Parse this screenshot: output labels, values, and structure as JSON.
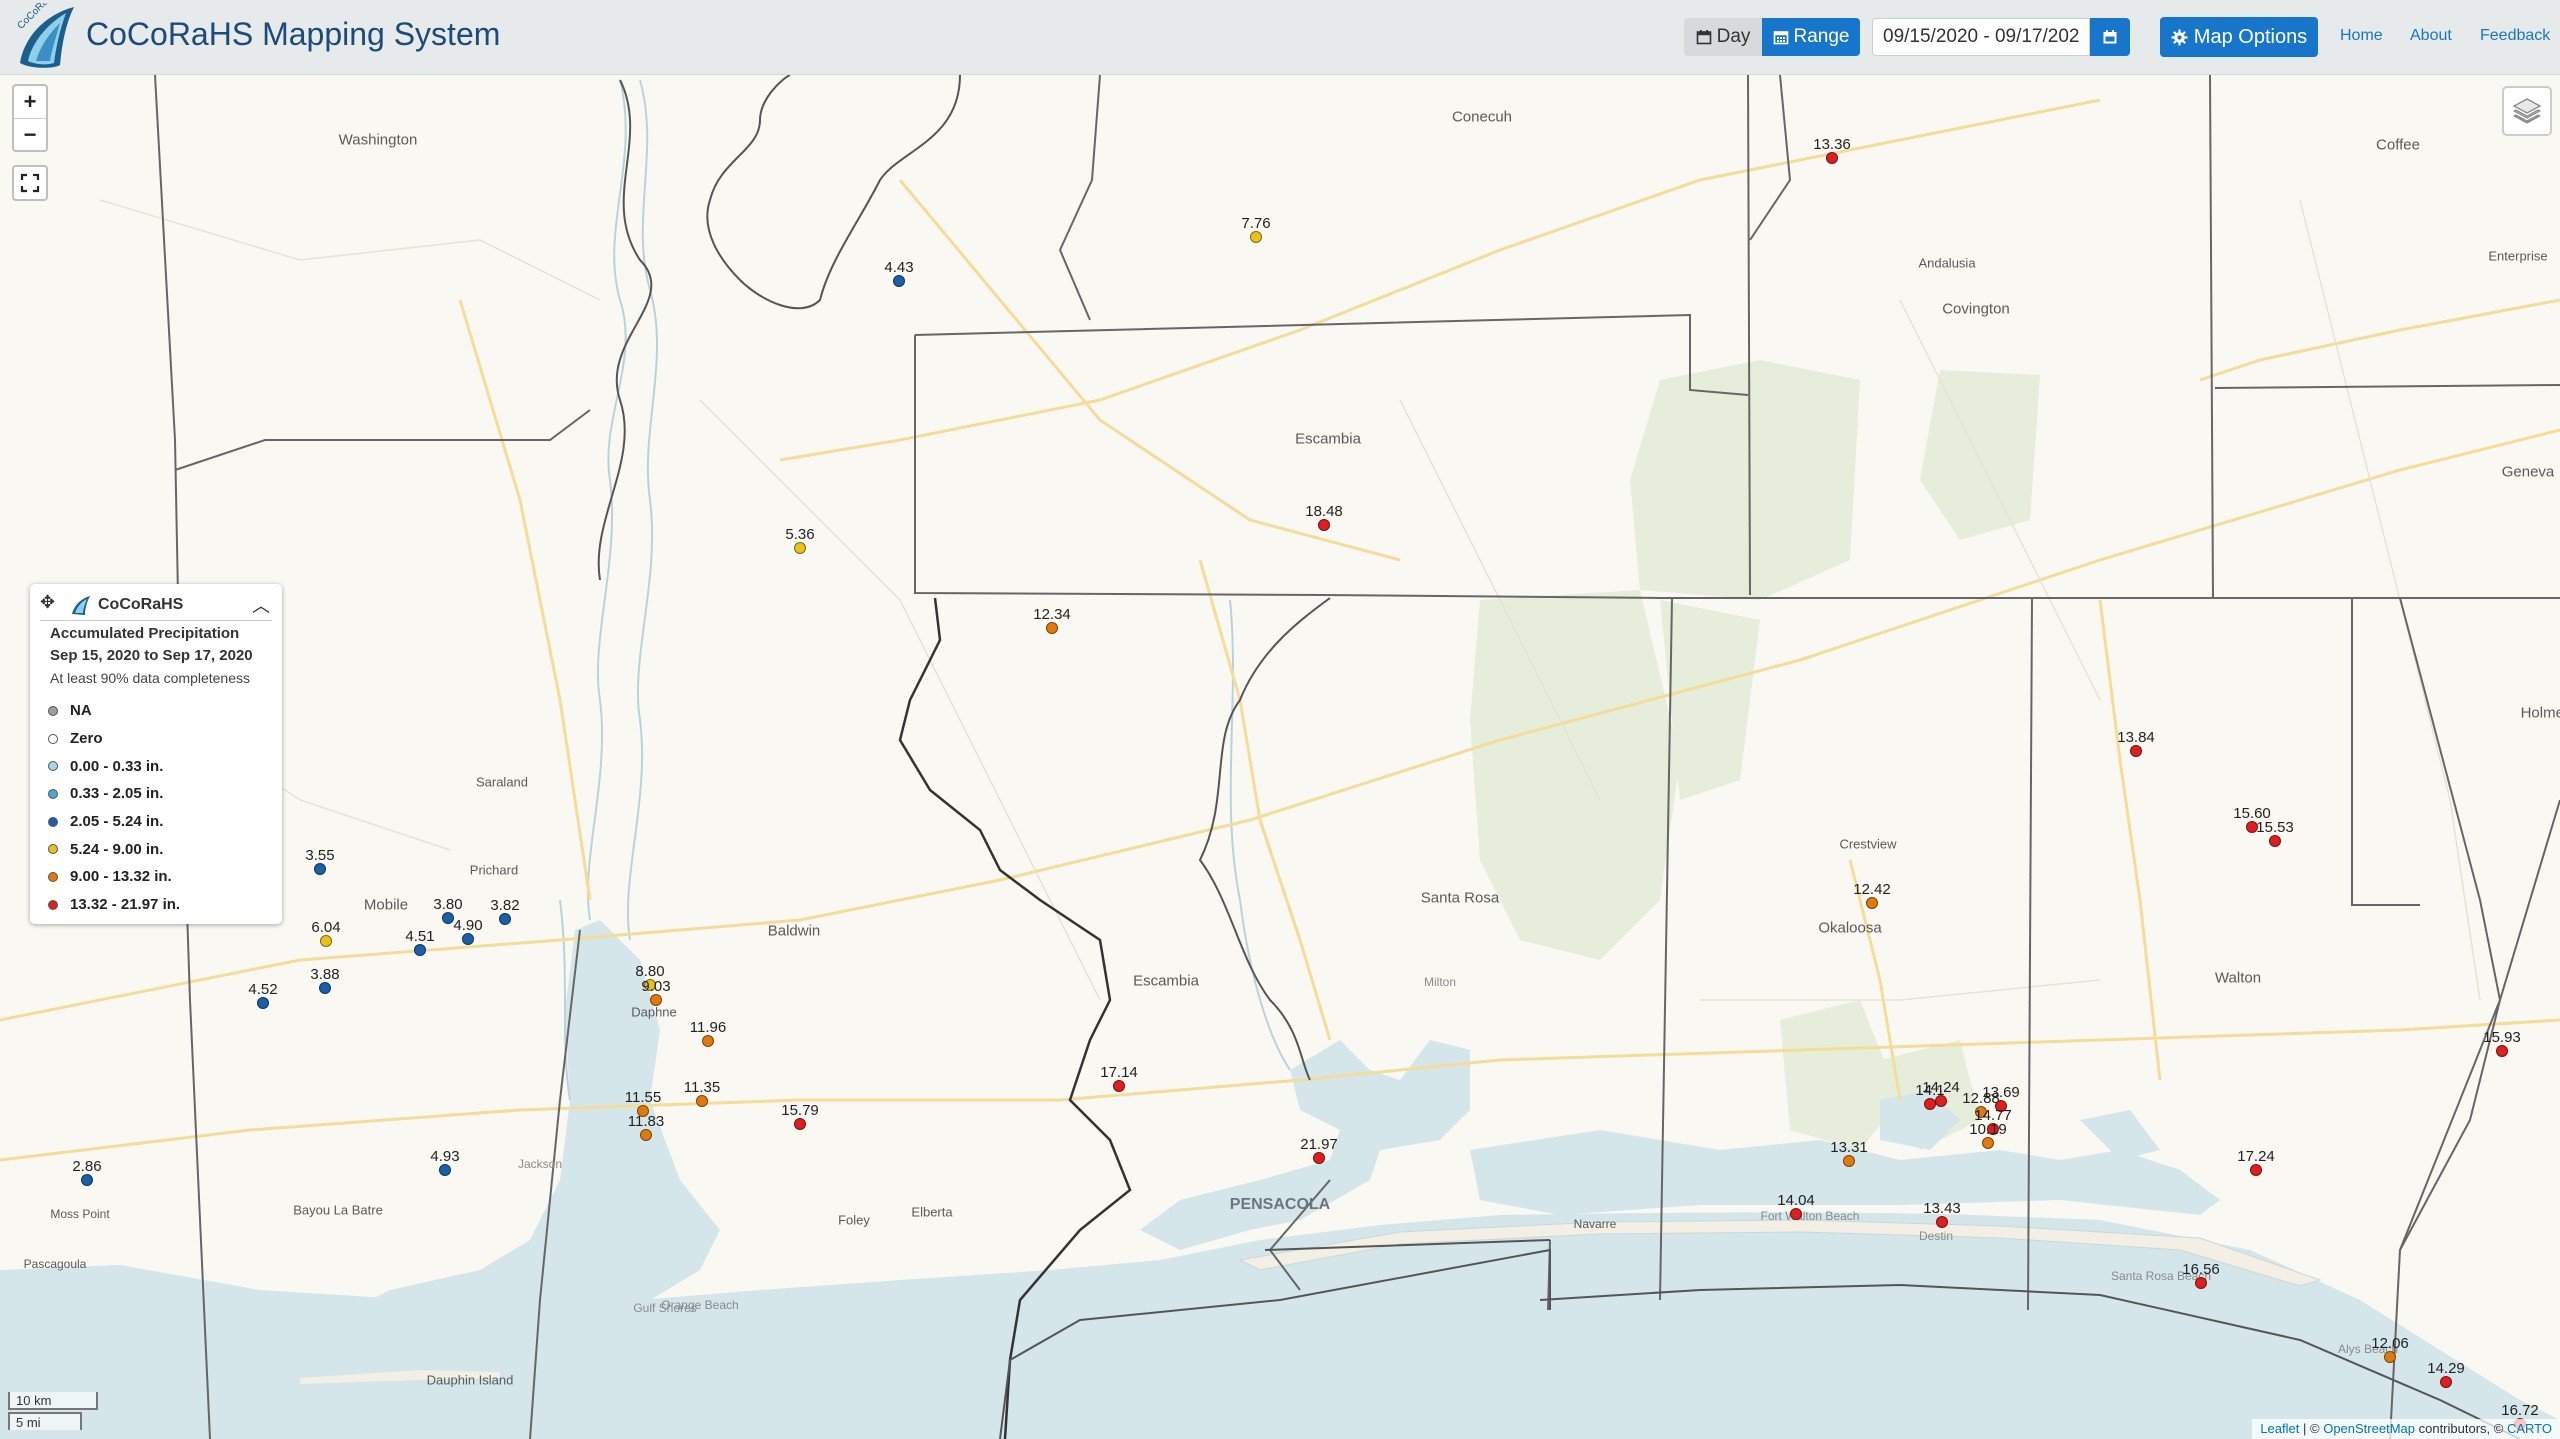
{
  "navbar": {
    "title": "CoCoRaHS Mapping System",
    "day_label": "Day",
    "range_label": "Range",
    "date_range": "09/15/2020 - 09/17/2020",
    "map_options_label": "Map Options",
    "links": {
      "home": "Home",
      "about": "About",
      "feedback": "Feedback"
    }
  },
  "map_controls": {
    "zoom_in": "+",
    "zoom_out": "−"
  },
  "legend": {
    "brand": "CoCoRaHS",
    "title": "Accumulated Precipitation",
    "dates": "Sep 15, 2020 to Sep 17, 2020",
    "note": "At least 90% data completeness",
    "items": [
      {
        "label": "NA",
        "color": "#9e9e9e"
      },
      {
        "label": "Zero",
        "color": "#ffffff"
      },
      {
        "label": "0.00 - 0.33 in.",
        "color": "#a8d0e6"
      },
      {
        "label": "0.33 - 2.05 in.",
        "color": "#4fa3d1"
      },
      {
        "label": "2.05 - 5.24 in.",
        "color": "#1d5fa6"
      },
      {
        "label": "5.24 - 9.00 in.",
        "color": "#e8c21a"
      },
      {
        "label": "9.00 - 13.32 in.",
        "color": "#e07a10"
      },
      {
        "label": "13.32 - 21.97 in.",
        "color": "#dd1f1f"
      }
    ]
  },
  "place_labels": [
    "Washington",
    "Conecuh",
    "Coffee",
    "Andalusia",
    "Covington",
    "Enterprise",
    "Escambia",
    "Geneva",
    "Holmes",
    "Crestview",
    "Saraland",
    "Prichard",
    "Mobile",
    "Baldwin",
    "Escambia",
    "Santa Rosa",
    "Okaloosa",
    "Walton",
    "Milton",
    "Daphne",
    "Bayou La Batre",
    "Foley",
    "Elberta",
    "PENSACOLA",
    "Navarre",
    "Fort Walton Beach",
    "Destin",
    "Santa Rosa Beach",
    "Alys Beach",
    "Moss Point",
    "Pascagoula",
    "Dauphin Island",
    "Gulf Shores",
    "Jackson",
    "Orange Beach"
  ],
  "stations": [
    {
      "value": "13.36",
      "color": "#dd1f1f"
    },
    {
      "value": "7.76",
      "color": "#e8c21a"
    },
    {
      "value": "4.43",
      "color": "#1d5fa6"
    },
    {
      "value": "18.48",
      "color": "#dd1f1f"
    },
    {
      "value": "5.36",
      "color": "#e8c21a"
    },
    {
      "value": "12.34",
      "color": "#e07a10"
    },
    {
      "value": "13.84",
      "color": "#dd1f1f"
    },
    {
      "value": "15.60",
      "color": "#dd1f1f"
    },
    {
      "value": "15.53",
      "color": "#dd1f1f"
    },
    {
      "value": "12.42",
      "color": "#e07a10"
    },
    {
      "value": "3.55",
      "color": "#1d5fa6"
    },
    {
      "value": "3.80",
      "color": "#1d5fa6"
    },
    {
      "value": "3.82",
      "color": "#1d5fa6"
    },
    {
      "value": "6.04",
      "color": "#e8c21a"
    },
    {
      "value": "4.51",
      "color": "#1d5fa6"
    },
    {
      "value": "4.90",
      "color": "#1d5fa6"
    },
    {
      "value": "8.80",
      "color": "#e8c21a"
    },
    {
      "value": "9.03",
      "color": "#e07a10"
    },
    {
      "value": "4.52",
      "color": "#1d5fa6"
    },
    {
      "value": "3.88",
      "color": "#1d5fa6"
    },
    {
      "value": "11.96",
      "color": "#e07a10"
    },
    {
      "value": "15.93",
      "color": "#dd1f1f"
    },
    {
      "value": "17.14",
      "color": "#dd1f1f"
    },
    {
      "value": "11.55",
      "color": "#e07a10"
    },
    {
      "value": "11.35",
      "color": "#e07a10"
    },
    {
      "value": "15.79",
      "color": "#dd1f1f"
    },
    {
      "value": "11.83",
      "color": "#e07a10"
    },
    {
      "value": "14.24",
      "color": "#dd1f1f"
    },
    {
      "value": "14.1",
      "color": "#dd1f1f"
    },
    {
      "value": "12.88",
      "color": "#e07a10"
    },
    {
      "value": "13.69",
      "color": "#dd1f1f"
    },
    {
      "value": "14.77",
      "color": "#dd1f1f"
    },
    {
      "value": "10.19",
      "color": "#e07a10"
    },
    {
      "value": "21.97",
      "color": "#dd1f1f"
    },
    {
      "value": "2.86",
      "color": "#1d5fa6"
    },
    {
      "value": "4.93",
      "color": "#1d5fa6"
    },
    {
      "value": "13.31",
      "color": "#e07a10"
    },
    {
      "value": "17.24",
      "color": "#dd1f1f"
    },
    {
      "value": "14.04",
      "color": "#dd1f1f"
    },
    {
      "value": "13.43",
      "color": "#dd1f1f"
    },
    {
      "value": "16.56",
      "color": "#dd1f1f"
    },
    {
      "value": "12.06",
      "color": "#e07a10"
    },
    {
      "value": "14.29",
      "color": "#dd1f1f"
    },
    {
      "value": "16.72",
      "color": "#dd1f1f"
    }
  ],
  "scale": {
    "metric": "10 km",
    "imperial": "5 mi"
  },
  "attribution": {
    "leaflet": "Leaflet",
    "osm_prefix": "| ©",
    "osm": "OpenStreetMap",
    "carto_prefix": "contributors, ©",
    "carto": "CARTO"
  }
}
